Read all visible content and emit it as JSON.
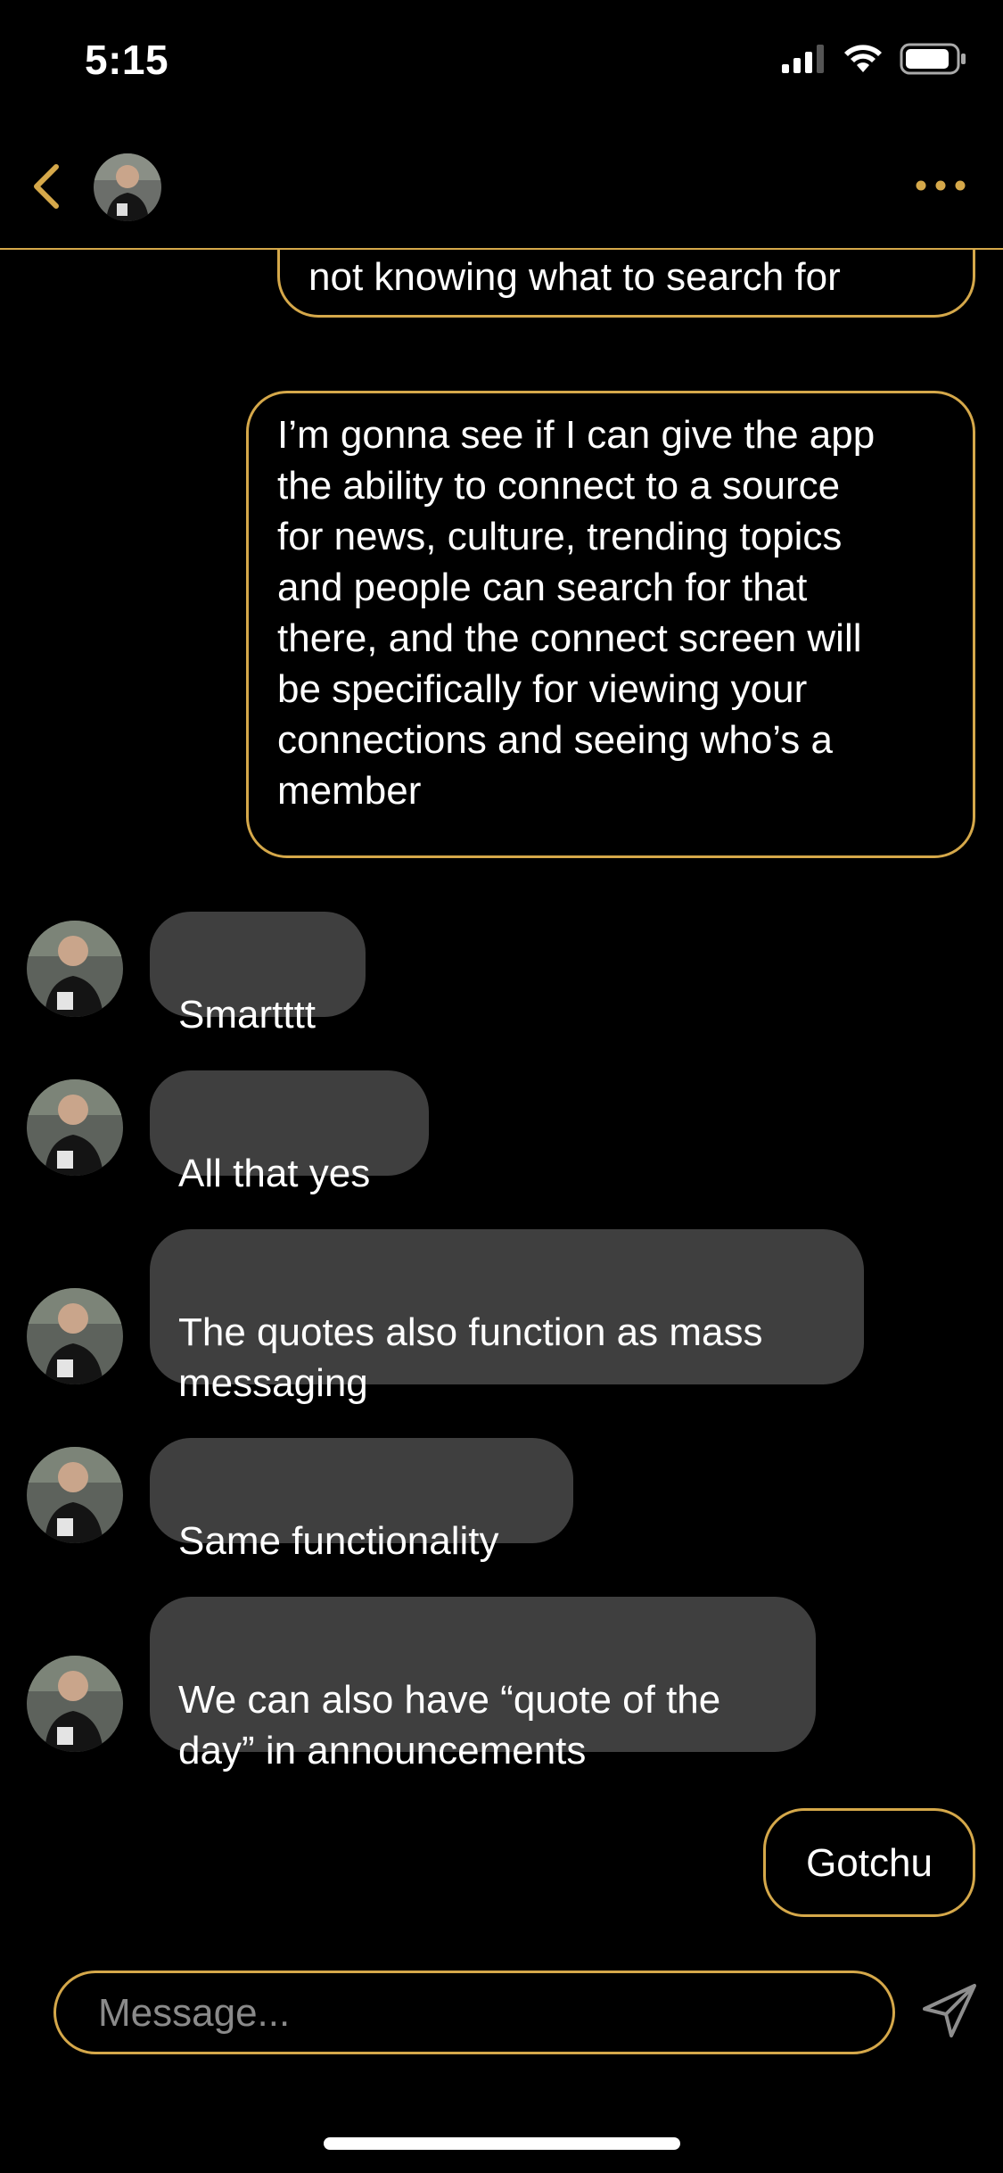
{
  "status_bar": {
    "time": "5:15",
    "icons": [
      "signal-icon",
      "wifi-icon",
      "battery-icon"
    ]
  },
  "header": {
    "back_icon": "chevron-left-icon",
    "contact_name": "",
    "more_icon": "ellipsis-icon"
  },
  "messages": {
    "out_cut": {
      "text": "not knowing what to search for"
    },
    "out_long": {
      "lines": [
        "I’m gonna see if I can give the app",
        "the ability to connect to a source",
        "for news, culture, trending topics",
        "and people can search for that",
        "there, and the connect screen will",
        "be specifically for viewing your",
        "connections and seeing who’s a",
        "member"
      ]
    },
    "in_1": {
      "text": "Smartttt"
    },
    "in_2": {
      "text": "All that yes"
    },
    "in_3": {
      "text": "The quotes also function as mass\nmessaging"
    },
    "in_4": {
      "text": "Same functionality"
    },
    "in_5": {
      "text": "We can also have “quote of the\nday” in announcements"
    },
    "out_last": {
      "text": "Gotchu"
    }
  },
  "composer": {
    "placeholder": "Message...",
    "value": "",
    "send_icon": "paper-plane-icon"
  },
  "colors": {
    "accent": "#d5a84a",
    "incoming_bubble": "#3f3f3f",
    "background": "#000000"
  }
}
